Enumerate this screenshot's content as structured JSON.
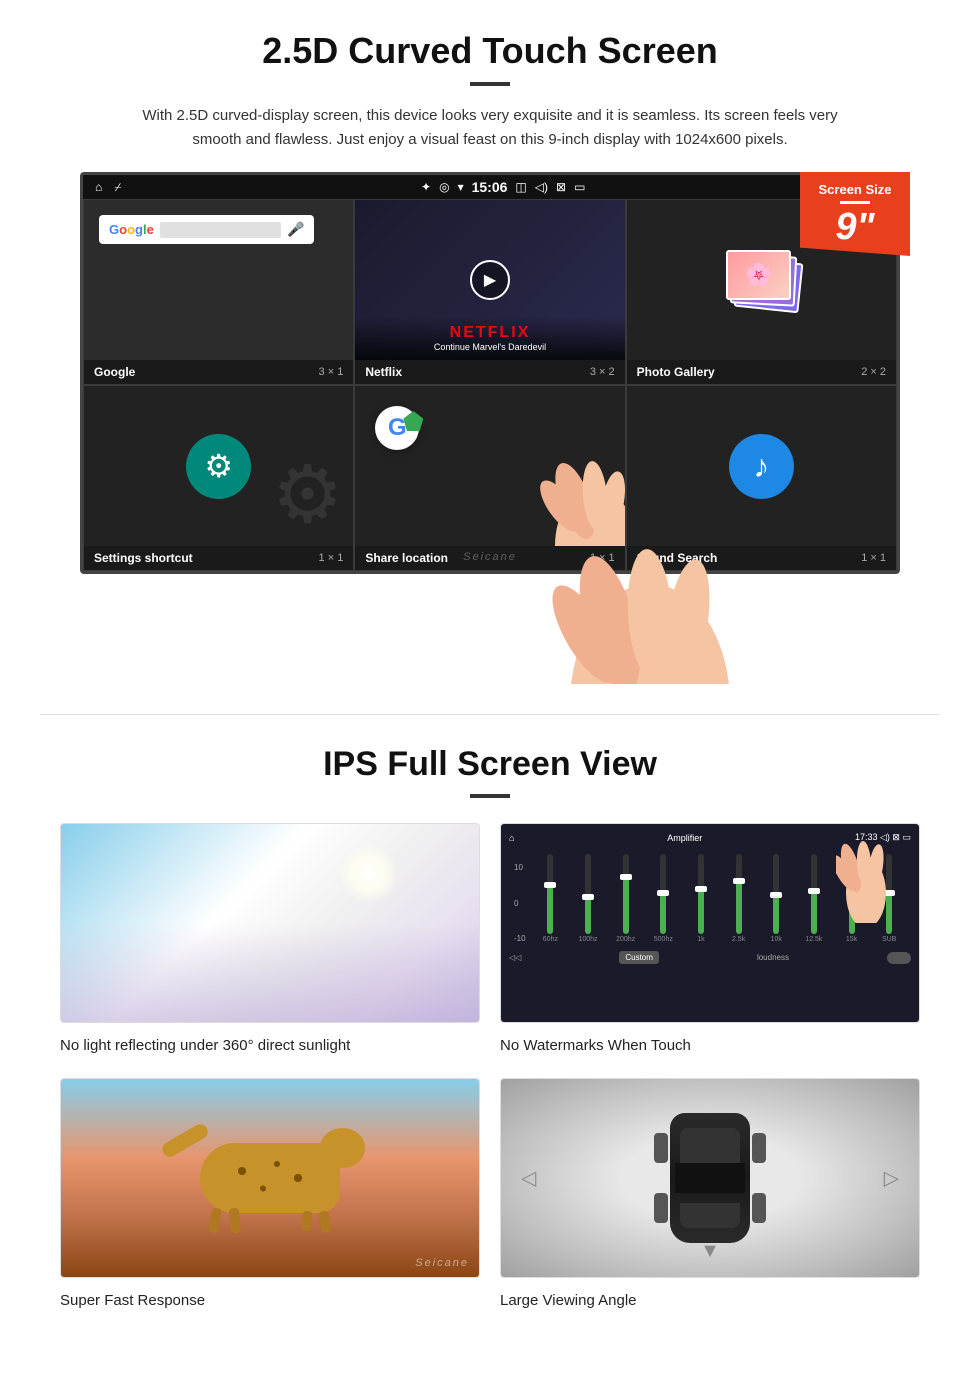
{
  "section1": {
    "title": "2.5D Curved Touch Screen",
    "description": "With 2.5D curved-display screen, this device looks very exquisite and it is seamless. Its screen feels very smooth and flawless. Just enjoy a visual feast on this 9-inch display with 1024x600 pixels.",
    "badge": {
      "label": "Screen Size",
      "size": "9\""
    },
    "statusBar": {
      "bluetooth": "✦",
      "location": "◎",
      "signal": "▼",
      "time": "15:06",
      "camera": "⬜",
      "volume": "◁)",
      "x": "⊠",
      "screen": "▭"
    },
    "apps": [
      {
        "name": "Google",
        "size": "3 × 1",
        "type": "google"
      },
      {
        "name": "Netflix",
        "size": "3 × 2",
        "type": "netflix",
        "overlay": {
          "brand": "NETFLIX",
          "subtitle": "Continue Marvel's Daredevil"
        }
      },
      {
        "name": "Photo Gallery",
        "size": "2 × 2",
        "type": "gallery"
      },
      {
        "name": "Settings shortcut",
        "size": "1 × 1",
        "type": "settings"
      },
      {
        "name": "Share location",
        "size": "1 × 1",
        "type": "share"
      },
      {
        "name": "Sound Search",
        "size": "1 × 1",
        "type": "sound"
      }
    ],
    "watermark": "Seicane"
  },
  "section2": {
    "title": "IPS Full Screen View",
    "features": [
      {
        "label": "No light reflecting under 360° direct sunlight",
        "type": "sunlight"
      },
      {
        "label": "No Watermarks When Touch",
        "type": "amplifier"
      },
      {
        "label": "Super Fast Response",
        "type": "cheetah"
      },
      {
        "label": "Large Viewing Angle",
        "type": "car"
      }
    ],
    "watermark": "Seicane"
  }
}
